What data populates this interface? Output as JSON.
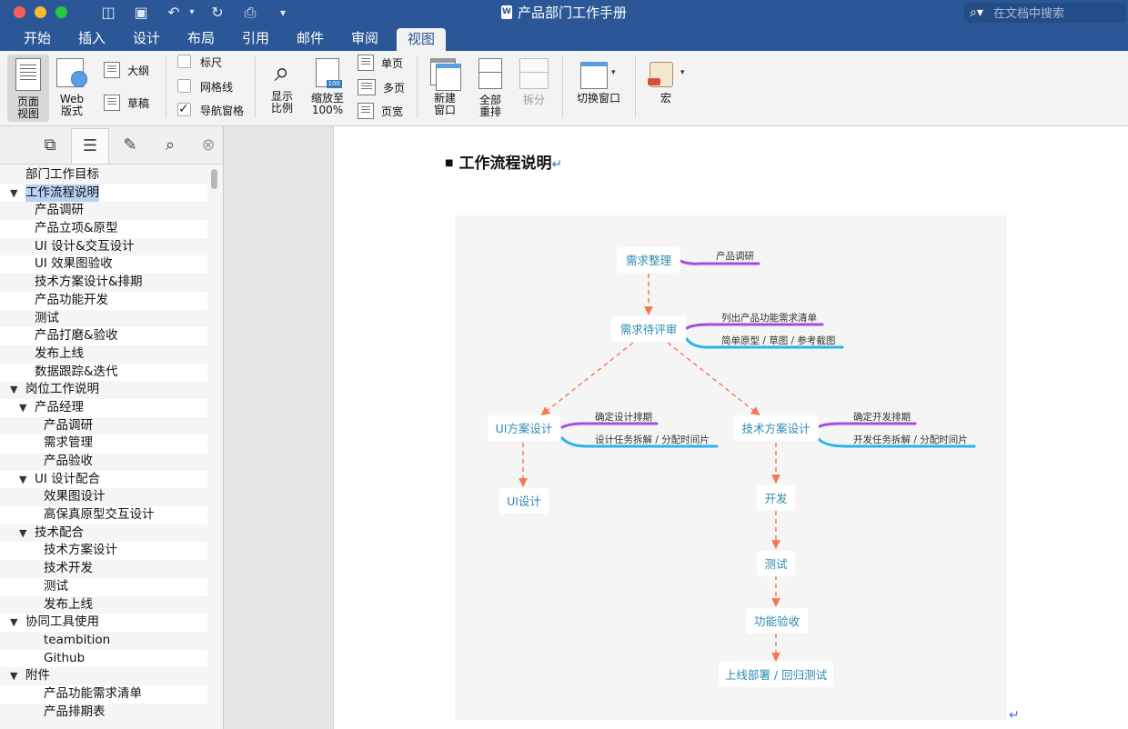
{
  "window": {
    "title": "产品部门工作手册",
    "search_placeholder": "在文档中搜索"
  },
  "tabs": [
    "开始",
    "插入",
    "设计",
    "布局",
    "引用",
    "邮件",
    "审阅",
    "视图"
  ],
  "active_tab": "视图",
  "ribbon": {
    "page_view": "页面\n视图",
    "web_view": "Web\n版式",
    "outline": "大纲",
    "draft": "草稿",
    "ruler": "标尺",
    "gridlines": "网格线",
    "nav_pane": "导航窗格",
    "nav_pane_checked": true,
    "zoom": "显示\n比例",
    "zoom100": "缩放至\n100%",
    "one_page": "单页",
    "multi_page": "多页",
    "page_width": "页宽",
    "new_window": "新建\n窗口",
    "arrange_all": "全部\n重排",
    "split": "拆分",
    "switch_window": "切换窗口",
    "macros": "宏"
  },
  "outline": [
    {
      "text": "部门工作目标",
      "level": 0,
      "toggle": ""
    },
    {
      "text": "工作流程说明",
      "level": 0,
      "toggle": "▼",
      "selected": true
    },
    {
      "text": "产品调研",
      "level": 1,
      "toggle": ""
    },
    {
      "text": "产品立项&原型",
      "level": 1,
      "toggle": ""
    },
    {
      "text": "UI 设计&交互设计",
      "level": 1,
      "toggle": ""
    },
    {
      "text": "UI 效果图验收",
      "level": 1,
      "toggle": ""
    },
    {
      "text": "技术方案设计&排期",
      "level": 1,
      "toggle": ""
    },
    {
      "text": "产品功能开发",
      "level": 1,
      "toggle": ""
    },
    {
      "text": "测试",
      "level": 1,
      "toggle": ""
    },
    {
      "text": "产品打磨&验收",
      "level": 1,
      "toggle": ""
    },
    {
      "text": "发布上线",
      "level": 1,
      "toggle": ""
    },
    {
      "text": "数据跟踪&迭代",
      "level": 1,
      "toggle": ""
    },
    {
      "text": "岗位工作说明",
      "level": 0,
      "toggle": "▼"
    },
    {
      "text": "产品经理",
      "level": 1,
      "toggle": "▼"
    },
    {
      "text": "产品调研",
      "level": 2,
      "toggle": ""
    },
    {
      "text": "需求管理",
      "level": 2,
      "toggle": ""
    },
    {
      "text": "产品验收",
      "level": 2,
      "toggle": ""
    },
    {
      "text": "UI 设计配合",
      "level": 1,
      "toggle": "▼"
    },
    {
      "text": "效果图设计",
      "level": 2,
      "toggle": ""
    },
    {
      "text": "高保真原型交互设计",
      "level": 2,
      "toggle": ""
    },
    {
      "text": "技术配合",
      "level": 1,
      "toggle": "▼"
    },
    {
      "text": "技术方案设计",
      "level": 2,
      "toggle": ""
    },
    {
      "text": "技术开发",
      "level": 2,
      "toggle": ""
    },
    {
      "text": "测试",
      "level": 2,
      "toggle": ""
    },
    {
      "text": "发布上线",
      "level": 2,
      "toggle": ""
    },
    {
      "text": "协同工具使用",
      "level": 0,
      "toggle": "▼"
    },
    {
      "text": "teambition",
      "level": 2,
      "toggle": ""
    },
    {
      "text": "Github",
      "level": 2,
      "toggle": ""
    },
    {
      "text": "附件",
      "level": 0,
      "toggle": "▼"
    },
    {
      "text": "产品功能需求清单",
      "level": 2,
      "toggle": ""
    },
    {
      "text": "产品排期表",
      "level": 2,
      "toggle": ""
    }
  ],
  "document": {
    "heading": "工作流程说明",
    "return_mark": "↵",
    "diagram": {
      "nodes": {
        "req_sort": "需求整理",
        "req_review": "需求待评审",
        "ui_plan": "UI方案设计",
        "tech_plan": "技术方案设计",
        "ui_design": "UI设计",
        "develop": "开发",
        "test": "测试",
        "accept": "功能验收",
        "release": "上线部署 / 回归测试"
      },
      "labels": {
        "research": "产品调研",
        "list_req": "列出产品功能需求清单",
        "proto": "简单原型 / 草图 / 参考截图",
        "ui_sched": "确定设计排期",
        "ui_tasks": "设计任务拆解 / 分配时间片",
        "dev_sched": "确定开发排期",
        "dev_tasks": "开发任务拆解 / 分配时间片"
      },
      "colors": {
        "purple": "#a64be0",
        "blue": "#2ab4e8",
        "arrow": "#f07a52",
        "node_text": "#2a8ab0"
      }
    }
  }
}
